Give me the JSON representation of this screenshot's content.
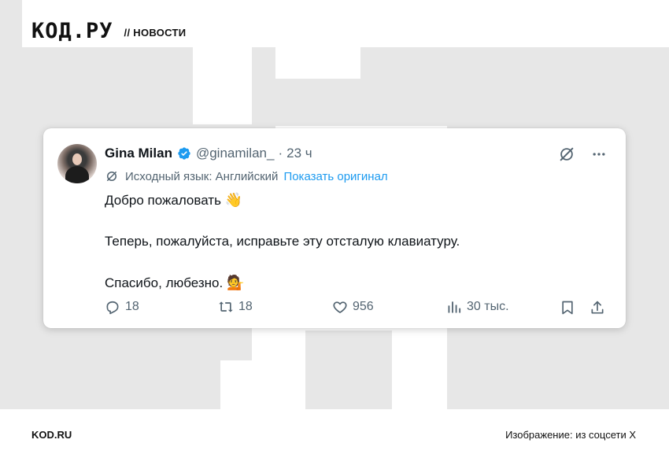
{
  "header": {
    "logo": "КОД.РУ",
    "section": "// НОВОСТИ"
  },
  "tweet": {
    "author_name": "Gina Milan",
    "handle": "@ginamilan_",
    "separator": "·",
    "time": "23 ч",
    "translation_note": "Исходный язык: Английский",
    "show_original": "Показать оригинал",
    "lines": [
      "Добро пожаловать",
      "Теперь, пожалуйста, исправьте эту отсталую клавиатуру.",
      "Спасибо, любезно."
    ],
    "emoji_1": "👋",
    "emoji_2": "💁",
    "stats": {
      "replies": "18",
      "retweets": "18",
      "likes": "956",
      "views": "30 тыс."
    },
    "colors": {
      "accent": "#1d9bf0",
      "muted": "#536471",
      "text": "#0f1419"
    },
    "icons": [
      "verified-badge-icon",
      "grok-icon",
      "more-icon",
      "translate-icon",
      "reply-icon",
      "retweet-icon",
      "like-icon",
      "views-icon",
      "bookmark-icon",
      "share-icon"
    ]
  },
  "footer": {
    "site": "KOD.RU",
    "credit": "Изображение: из соцсети X"
  }
}
